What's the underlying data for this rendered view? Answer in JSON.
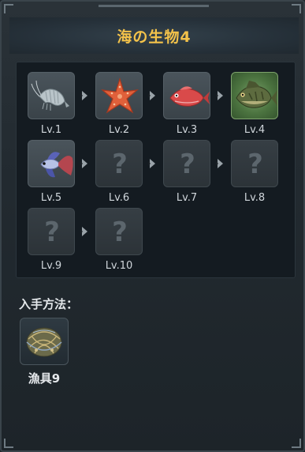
{
  "title": "海の生物4",
  "creatures": [
    {
      "level": "Lv.1",
      "icon": "shrimp-icon",
      "state": "unlocked"
    },
    {
      "level": "Lv.2",
      "icon": "starfish-icon",
      "state": "unlocked"
    },
    {
      "level": "Lv.3",
      "icon": "red-snapper-icon",
      "state": "unlocked"
    },
    {
      "level": "Lv.4",
      "icon": "bass-fish-icon",
      "state": "current"
    },
    {
      "level": "Lv.5",
      "icon": "betta-fish-icon",
      "state": "unlocked"
    },
    {
      "level": "Lv.6",
      "icon": "question-mark-icon",
      "state": "locked",
      "placeholder": "?"
    },
    {
      "level": "Lv.7",
      "icon": "question-mark-icon",
      "state": "locked",
      "placeholder": "?"
    },
    {
      "level": "Lv.8",
      "icon": "question-mark-icon",
      "state": "locked",
      "placeholder": "?"
    },
    {
      "level": "Lv.9",
      "icon": "question-mark-icon",
      "state": "locked",
      "placeholder": "?"
    },
    {
      "level": "Lv.10",
      "icon": "question-mark-icon",
      "state": "locked",
      "placeholder": "?"
    }
  ],
  "acquisition": {
    "label": "入手方法：",
    "items": [
      {
        "name": "漁具9",
        "icon": "fishing-net-icon"
      }
    ]
  },
  "colors": {
    "title": "#f3c24a",
    "highlight_slot": "#4c7440"
  }
}
